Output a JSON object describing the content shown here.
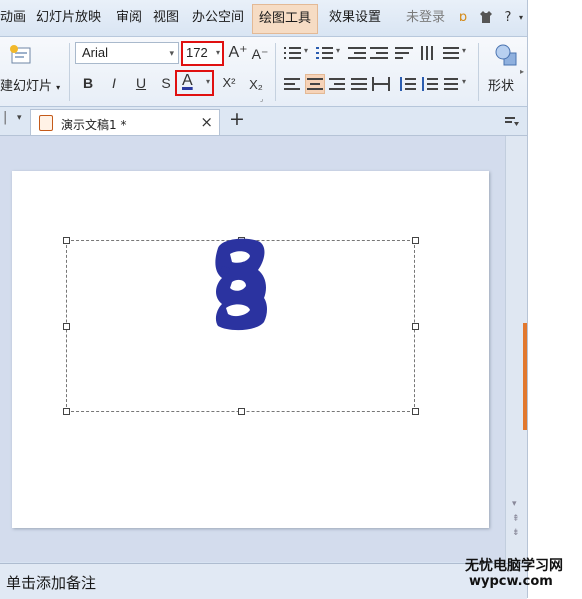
{
  "menu": {
    "items": [
      "动画",
      "幻灯片放映",
      "审阅",
      "视图",
      "办公空间",
      "绘图工具",
      "效果设置",
      "未登录"
    ],
    "active_item": "绘图工具",
    "help_label": "?"
  },
  "ribbon": {
    "new_slide_label": "建幻灯片",
    "font_name": "Arial",
    "font_size": "172",
    "shape_label": "形状",
    "bold": "B",
    "italic": "I",
    "underline": "U",
    "shadow": "S",
    "font_color": "A",
    "superscript": "X²",
    "subscript": "X₂",
    "grow": "A⁺",
    "shrink": "A⁻"
  },
  "tabs": {
    "doc_title": "演示文稿1 *",
    "close": "×",
    "new_tab": "+"
  },
  "notes": {
    "placeholder": "单击添加备注"
  },
  "watermark": {
    "line1": "无忧电脑学习网",
    "line2": "wypcw.com"
  },
  "colors": {
    "text_fill": "#2b33a0",
    "highlight_box": "#e01010",
    "active_tab": "#f6dcc4"
  }
}
